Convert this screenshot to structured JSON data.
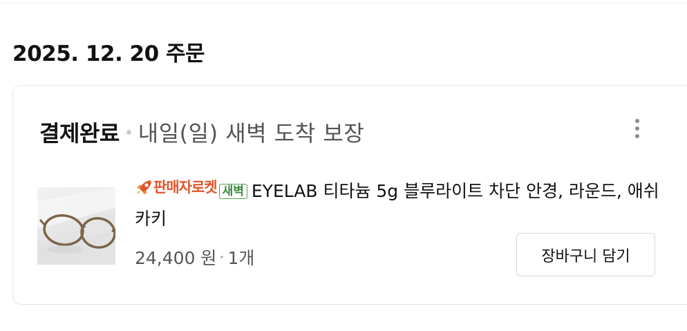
{
  "order": {
    "date_heading": "2025. 12. 20 주문",
    "status": "결제완료",
    "delivery_note": "내일(일) 새벽 도착 보장"
  },
  "product": {
    "rocket_badge": "판매자로켓",
    "dawn_badge": "새벽",
    "title": "EYELAB 티타늄 5g 블루라이트 차단 안경, 라운드, 애쉬카키",
    "price": "24,400 원",
    "quantity": "1개",
    "image_icon": "glasses-photo"
  },
  "actions": {
    "add_to_cart_label": "장바구니 담기",
    "more_icon": "kebab-menu-icon"
  },
  "colors": {
    "rocket_badge": "#e0572a",
    "dawn_badge": "#3a8c3e",
    "muted_text": "#555555"
  }
}
